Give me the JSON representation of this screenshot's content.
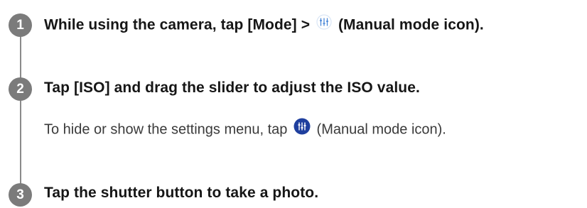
{
  "steps": [
    {
      "number": "1",
      "title_before": "While using the camera, tap [Mode] > ",
      "title_after": " (Manual mode icon).",
      "icon": "manual-mode-outline-icon"
    },
    {
      "number": "2",
      "title": "Tap [ISO] and drag the slider to adjust the ISO value.",
      "note_before": "To hide or show the settings menu, tap ",
      "note_after": " (Manual mode icon).",
      "icon": "manual-mode-filled-icon"
    },
    {
      "number": "3",
      "title": "Tap the shutter button to take a photo."
    }
  ],
  "colors": {
    "badge": "#7b7b7b",
    "line": "#8a8a8a",
    "icon_accent": "#4a88d8",
    "icon_fill": "#1f3f9e"
  }
}
